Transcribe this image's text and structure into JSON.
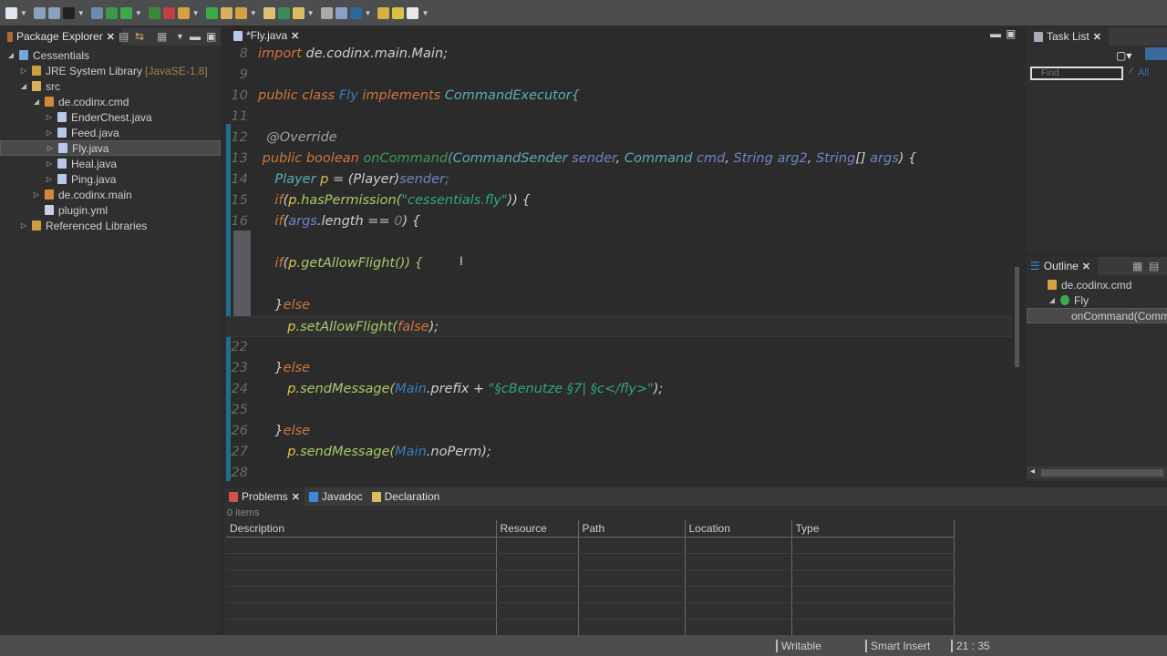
{
  "toolbar": {
    "icons": [
      "new-icon",
      "save-icon",
      "save-all-icon",
      "debug-icon",
      "skip-icon",
      "run-icon",
      "run-green-icon",
      "coverage-icon",
      "external-tools-icon",
      "new-package-icon",
      "new-class-icon",
      "open-type-icon",
      "open-folder-icon",
      "pen-icon",
      "search-icon",
      "annotation-icon",
      "task-icon",
      "editor-icon",
      "next-annotation-icon",
      "prev-annotation-icon",
      "back-icon",
      "forward-icon"
    ]
  },
  "package_explorer": {
    "title": "Package Explorer",
    "items": [
      {
        "label": "Cessentials",
        "depth": 0,
        "twisty": "◢",
        "icon": "#7aa3d8"
      },
      {
        "label": "JRE System Library",
        "suffix": "[JavaSE-1.8]",
        "depth": 1,
        "twisty": "▷",
        "icon": "#c9a040"
      },
      {
        "label": "src",
        "depth": 1,
        "twisty": "◢",
        "icon": "#d8b060"
      },
      {
        "label": "de.codinx.cmd",
        "depth": 2,
        "twisty": "◢",
        "icon": "#d08a3a"
      },
      {
        "label": "EnderChest.java",
        "depth": 3,
        "twisty": "▷",
        "icon": "#b8c8e8"
      },
      {
        "label": "Feed.java",
        "depth": 3,
        "twisty": "▷",
        "icon": "#b8c8e8"
      },
      {
        "label": "Fly.java",
        "depth": 3,
        "twisty": "▷",
        "icon": "#b8c8e8",
        "selected": true
      },
      {
        "label": "Heal.java",
        "depth": 3,
        "twisty": "▷",
        "icon": "#b8c8e8"
      },
      {
        "label": "Ping.java",
        "depth": 3,
        "twisty": "▷",
        "icon": "#b8c8e8"
      },
      {
        "label": "de.codinx.main",
        "depth": 2,
        "twisty": "▷",
        "icon": "#d08a3a"
      },
      {
        "label": "plugin.yml",
        "depth": 2,
        "twisty": "",
        "icon": "#c8d0e0"
      },
      {
        "label": "Referenced Libraries",
        "depth": 1,
        "twisty": "▷",
        "icon": "#c9a040"
      }
    ]
  },
  "editor": {
    "tab": "*Fly.java",
    "lines": [
      {
        "n": "8",
        "t": [
          [
            "import ",
            "kw"
          ],
          [
            "de.codinx.main.Main;",
            "nm"
          ]
        ]
      },
      {
        "n": "9",
        "t": []
      },
      {
        "n": "10",
        "t": [
          [
            "public class ",
            "kw"
          ],
          [
            "Fly ",
            "fi"
          ],
          [
            "implements ",
            "kw"
          ],
          [
            "CommandExecutor{",
            "ty"
          ]
        ]
      },
      {
        "n": "11",
        "t": []
      },
      {
        "n": "12",
        "t": [
          [
            "  @Override",
            "an"
          ]
        ]
      },
      {
        "n": "13",
        "t": [
          [
            " public boolean ",
            "kw"
          ],
          [
            "onCommand",
            "fn"
          ],
          [
            "(CommandSender ",
            "ty"
          ],
          [
            "sender",
            "pa"
          ],
          [
            ", ",
            "nm"
          ],
          [
            "Command ",
            "ty"
          ],
          [
            "cmd",
            "pa"
          ],
          [
            ", ",
            "nm"
          ],
          [
            "String ",
            "pa"
          ],
          [
            "arg2",
            "pa"
          ],
          [
            ", ",
            "nm"
          ],
          [
            "String",
            "pa"
          ],
          [
            "[] ",
            "nm"
          ],
          [
            "args",
            "pa"
          ],
          [
            ") {",
            "nm"
          ]
        ]
      },
      {
        "n": "14",
        "t": [
          [
            "    Player ",
            "ty"
          ],
          [
            "p",
            "lv"
          ],
          [
            " = (Player)",
            "nm"
          ],
          [
            "sender;",
            "pa"
          ]
        ]
      },
      {
        "n": "15",
        "t": [
          [
            "    if",
            "kw"
          ],
          [
            "(",
            "nm"
          ],
          [
            "p",
            "lv"
          ],
          [
            ".hasPermission(",
            "mt"
          ],
          [
            "\"cessentials.fly\"",
            "st"
          ],
          [
            ")) {",
            "nm"
          ]
        ]
      },
      {
        "n": "16",
        "t": [
          [
            "    if",
            "kw"
          ],
          [
            "(",
            "nm"
          ],
          [
            "args",
            "pa"
          ],
          [
            ".length == ",
            "nm"
          ],
          [
            "0",
            "num"
          ],
          [
            ") {",
            "nm"
          ]
        ]
      },
      {
        "n": "",
        "t": []
      },
      {
        "n": "",
        "t": [
          [
            "    if",
            "kw"
          ],
          [
            "(",
            "nm"
          ],
          [
            "p",
            "lv"
          ],
          [
            ".getAllowFlight()) {",
            "mt"
          ]
        ]
      },
      {
        "n": "",
        "t": []
      },
      {
        "n": "",
        "t": [
          [
            "    }",
            "nm"
          ],
          [
            "else",
            "kw"
          ]
        ]
      },
      {
        "n": "",
        "t": [
          [
            "       p",
            "lv"
          ],
          [
            ".setAllowFlight(",
            "mt"
          ],
          [
            "false",
            "kw"
          ],
          [
            ");",
            "nm"
          ]
        ],
        "current": true
      },
      {
        "n": "22",
        "t": []
      },
      {
        "n": "23",
        "t": [
          [
            "    }",
            "nm"
          ],
          [
            "else",
            "kw"
          ]
        ]
      },
      {
        "n": "24",
        "t": [
          [
            "       p",
            "lv"
          ],
          [
            ".sendMessage(",
            "mt"
          ],
          [
            "Main",
            "fi"
          ],
          [
            ".prefix + ",
            "nm"
          ],
          [
            "\"§cBenutze §7| §c</fly>\"",
            "st"
          ],
          [
            ");",
            "nm"
          ]
        ]
      },
      {
        "n": "25",
        "t": []
      },
      {
        "n": "26",
        "t": [
          [
            "    }",
            "nm"
          ],
          [
            "else",
            "kw"
          ]
        ]
      },
      {
        "n": "27",
        "t": [
          [
            "       p",
            "lv"
          ],
          [
            ".sendMessage(",
            "mt"
          ],
          [
            "Main",
            "fi"
          ],
          [
            ".noPerm);",
            "nm"
          ]
        ]
      },
      {
        "n": "28",
        "t": []
      }
    ]
  },
  "task_list": {
    "title": "Task List",
    "filter_placeholder": "Find",
    "all_label": "All"
  },
  "outline": {
    "title": "Outline",
    "items": [
      {
        "label": "de.codinx.cmd",
        "depth": 0
      },
      {
        "label": "Fly",
        "depth": 1
      },
      {
        "label": "onCommand(Comm",
        "depth": 2,
        "selected": true
      }
    ]
  },
  "problems": {
    "tabs": [
      "Problems",
      "Javadoc",
      "Declaration"
    ],
    "count": "0 items",
    "columns": [
      "Description",
      "Resource",
      "Path",
      "Location",
      "Type"
    ]
  },
  "status": {
    "writable": "Writable",
    "insert_mode": "Smart Insert",
    "position": "21 : 35"
  }
}
